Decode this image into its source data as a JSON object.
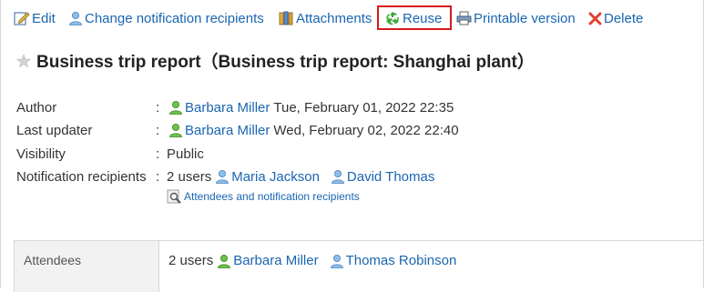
{
  "toolbar": {
    "edit": "Edit",
    "change_recipients": "Change notification recipients",
    "attachments": "Attachments",
    "reuse": "Reuse",
    "printable": "Printable version",
    "delete": "Delete",
    "highlight_color": "#d9191f"
  },
  "title": "Business trip report（Business trip report: Shanghai plant）",
  "meta": {
    "author_label": "Author",
    "author_name": "Barbara Miller",
    "author_date": "Tue, February 01, 2022 22:35",
    "updater_label": "Last updater",
    "updater_name": "Barbara Miller",
    "updater_date": "Wed, February 02, 2022 22:40",
    "visibility_label": "Visibility",
    "visibility_value": "Public",
    "recipients_label": "Notification recipients",
    "recipients_count": "2 users",
    "recipient_1": "Maria Jackson",
    "recipient_2": "David Thomas",
    "colon": ":",
    "attendees_link": "Attendees and notification recipients"
  },
  "attendees": {
    "label": "Attendees",
    "count": "2 users",
    "user_1": "Barbara Miller",
    "user_2": "Thomas Robinson"
  },
  "colors": {
    "link": "#1a66b0",
    "user_green": "#4caf3c",
    "user_blue": "#6fa8dc"
  },
  "icons": {
    "edit": "edit-icon",
    "user": "user-icon",
    "attachments": "books-icon",
    "reuse": "recycle-icon",
    "print": "printer-icon",
    "delete": "delete-x-icon",
    "star": "star-icon",
    "magnifier": "magnifier-icon"
  }
}
